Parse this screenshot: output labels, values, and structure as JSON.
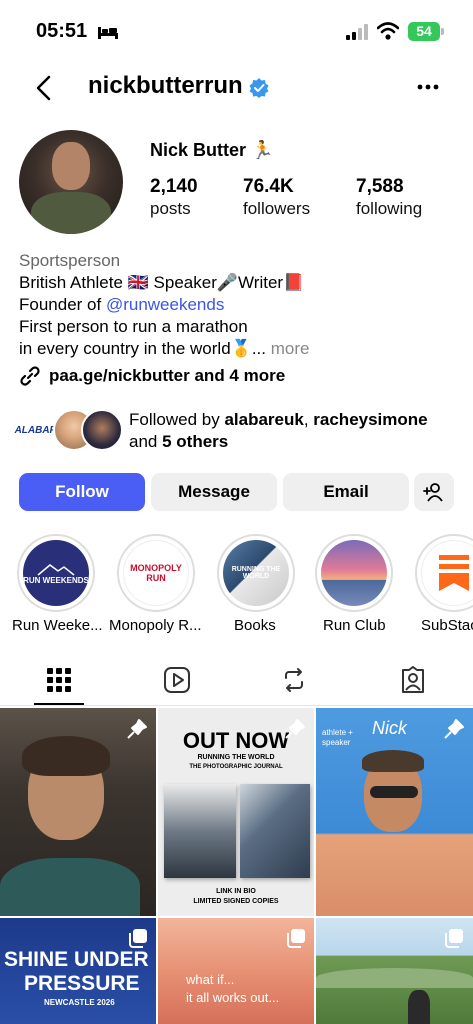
{
  "status_bar": {
    "time": "05:51",
    "battery": "54"
  },
  "header": {
    "username": "nickbutterrun"
  },
  "profile": {
    "display_name": "Nick Butter 🏃",
    "stats": [
      {
        "value": "2,140",
        "label": "posts"
      },
      {
        "value": "76.4K",
        "label": "followers"
      },
      {
        "value": "7,588",
        "label": "following"
      }
    ]
  },
  "bio": {
    "category": "Sportsperson",
    "line1": "British Athlete 🇬🇧 Speaker🎤Writer📕",
    "line2_prefix": "Founder of ",
    "line2_mention": "@runweekends",
    "line3": "First person to run a marathon",
    "line4": "in every country in the world🥇... ",
    "more": "more"
  },
  "links": {
    "text": "paa.ge/nickbutter and 4 more"
  },
  "followed_by": {
    "prefix": "Followed by ",
    "user1": "alabareuk",
    "sep": ", ",
    "user2": "racheysimone",
    "line2_prefix": "and ",
    "others": "5 others",
    "avatar1_text": "ALABARE"
  },
  "buttons": {
    "follow": "Follow",
    "message": "Message",
    "email": "Email"
  },
  "highlights": [
    {
      "label": "Run Weeke...",
      "cover_text": "RUN WEEKENDS"
    },
    {
      "label": "Monopoly R...",
      "cover_text": "MONOPOLY RUN"
    },
    {
      "label": "Books",
      "cover_text": "RUNNING THE WORLD"
    },
    {
      "label": "Run Club",
      "cover_text": ""
    },
    {
      "label": "SubStac",
      "cover_text": ""
    }
  ],
  "posts": {
    "p2_title": "OUT NOW",
    "p2_sub": "RUNNING THE WORLD",
    "p2_sub2": "THE PHOTOGRAPHIC JOURNAL",
    "p2_footer1": "LINK IN BIO",
    "p2_footer2": "LIMITED SIGNED COPIES",
    "p3_name": "Nick",
    "p3_tag": "athlete + speaker",
    "p4_title1": "SHINE UNDER",
    "p4_title2": "PRESSURE",
    "p4_sub": "NEWCASTLE 2026",
    "p5_text1": "what if...",
    "p5_text2": "it all works out..."
  },
  "colors": {
    "accent": "#4a5df5",
    "link": "#3b55e6",
    "battery": "#34c759"
  }
}
